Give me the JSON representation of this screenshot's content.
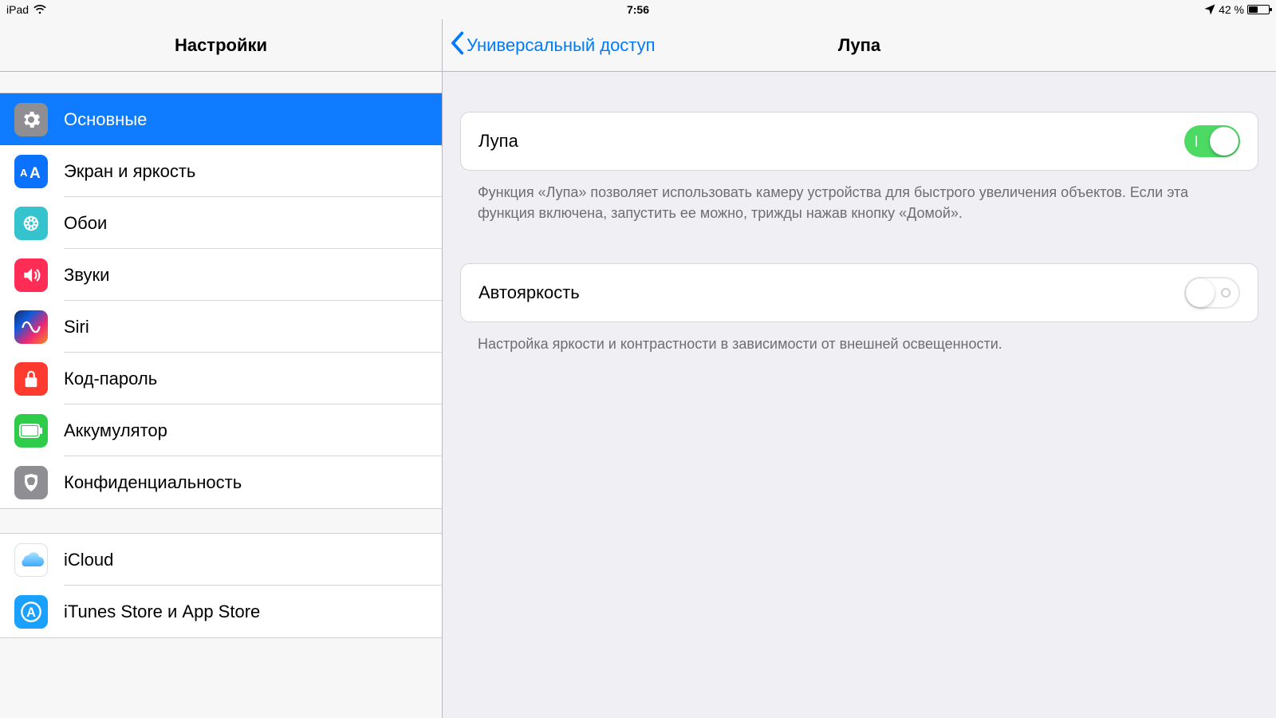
{
  "status": {
    "device": "iPad",
    "time": "7:56",
    "battery_pct": "42 %"
  },
  "sidebar": {
    "title": "Настройки",
    "groups": [
      {
        "items": [
          {
            "id": "general",
            "label": "Основные",
            "icon": "general",
            "selected": true
          },
          {
            "id": "display",
            "label": "Экран и яркость",
            "icon": "display",
            "selected": false
          },
          {
            "id": "wallpaper",
            "label": "Обои",
            "icon": "wallp",
            "selected": false
          },
          {
            "id": "sounds",
            "label": "Звуки",
            "icon": "sounds",
            "selected": false
          },
          {
            "id": "siri",
            "label": "Siri",
            "icon": "siri",
            "selected": false
          },
          {
            "id": "passcode",
            "label": "Код-пароль",
            "icon": "passcode",
            "selected": false
          },
          {
            "id": "battery",
            "label": "Аккумулятор",
            "icon": "battery",
            "selected": false
          },
          {
            "id": "privacy",
            "label": "Конфиденциальность",
            "icon": "privacy",
            "selected": false
          }
        ]
      },
      {
        "items": [
          {
            "id": "icloud",
            "label": "iCloud",
            "icon": "icloud",
            "selected": false
          },
          {
            "id": "stores",
            "label": "iTunes Store и App Store",
            "icon": "store",
            "selected": false
          }
        ]
      }
    ]
  },
  "detail": {
    "back_label": "Универсальный доступ",
    "title": "Лупа",
    "groups": [
      {
        "rows": [
          {
            "id": "magnifier",
            "label": "Лупа",
            "toggle": true
          }
        ],
        "footer": "Функция «Лупа» позволяет использовать камеру устройства для быстрого увеличения объектов. Если эта функция включена, запустить ее можно, трижды нажав кнопку «Домой»."
      },
      {
        "rows": [
          {
            "id": "autobright",
            "label": "Автояркость",
            "toggle": false
          }
        ],
        "footer": "Настройка яркости и контрастности в зависимости от внешней освещенности."
      }
    ]
  }
}
